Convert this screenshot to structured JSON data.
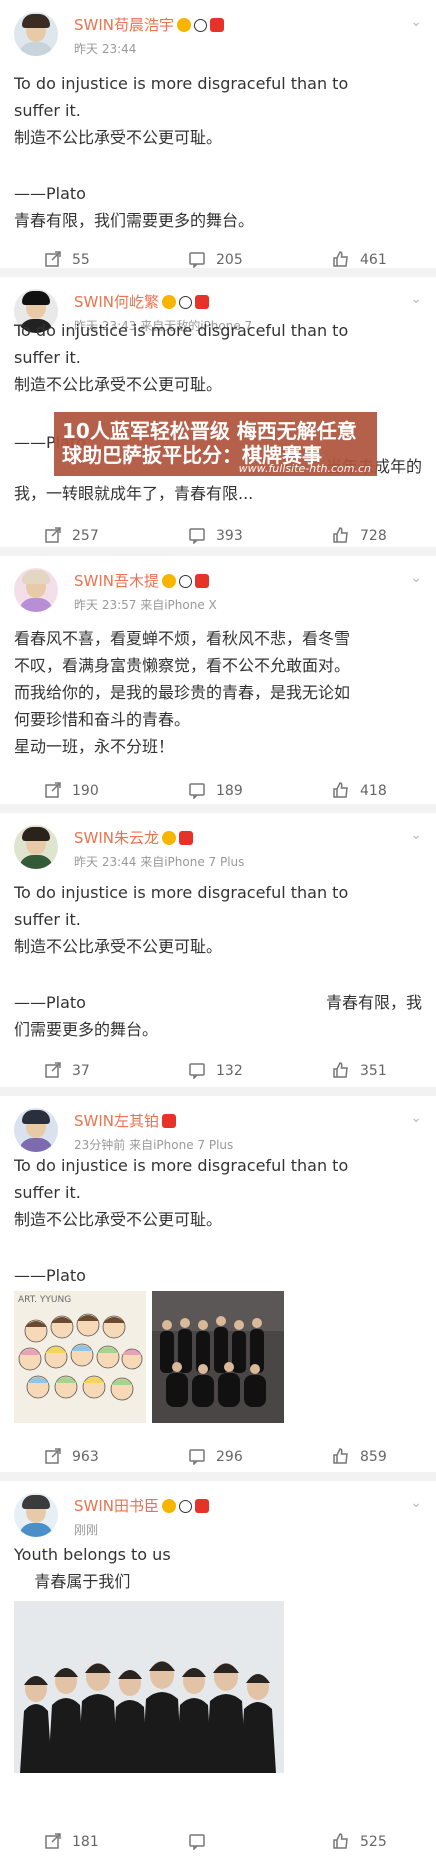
{
  "posts": [
    {
      "username": "SWIN苟晨浩宇",
      "meta": "昨天 23:44",
      "text_en": "To do injustice is more disgraceful than to\nsuffer it.",
      "text_zh": "制造不公比承受不公更可耻。",
      "signature": "——Plato",
      "extra": "青春有限，我们需要更多的舞台。",
      "actions": {
        "repost": "55",
        "comment": "205",
        "like": "461"
      }
    },
    {
      "username": "SWIN何屹繁",
      "meta": "昨天 23:43  来自无敌的iPhone 7",
      "text_en": "To do injustice is more disgraceful than to\nsuffer it.",
      "text_zh": "制造不公比承受不公更可耻。",
      "signature": "——Plato",
      "side_note": "当年未成年的",
      "extra": "我，一转眼就成年了，青春有限...",
      "actions": {
        "repost": "257",
        "comment": "393",
        "like": "728"
      }
    },
    {
      "username": "SWIN吾木提",
      "meta": "昨天 23:57  来自iPhone X",
      "text": "看春风不喜，看夏蝉不烦，看秋风不悲，看冬雪\n不叹，看满身富贵懒察觉，看不公不允敢面对。\n而我给你的，是我的最珍贵的青春，是我无论如\n何要珍惜和奋斗的青春。\n星动一班，永不分班！",
      "actions": {
        "repost": "190",
        "comment": "189",
        "like": "418"
      }
    },
    {
      "username": "SWIN朱云龙",
      "meta": "昨天 23:44  来自iPhone 7 Plus",
      "text_en": "To do injustice is more disgraceful than to\nsuffer it.",
      "text_zh": "制造不公比承受不公更可耻。",
      "signature": "——Plato",
      "side_note": "青春有限，我",
      "extra": "们需要更多的舞台。",
      "actions": {
        "repost": "37",
        "comment": "132",
        "like": "351"
      }
    },
    {
      "username": "SWIN左其铂",
      "meta": "23分钟前  来自iPhone 7 Plus",
      "text_en": "To do injustice is more disgraceful than to\nsuffer it.",
      "text_zh": "制造不公比承受不公更可耻。",
      "signature": "——Plato",
      "image_caption": "ART. YYUNG",
      "actions": {
        "repost": "963",
        "comment": "296",
        "like": "859"
      }
    },
    {
      "username": "SWIN田书臣",
      "meta": "刚刚",
      "text_en": "Youth belongs to us",
      "text_zh": "    青春属于我们",
      "actions": {
        "repost": "181",
        "comment": "",
        "like": "525"
      }
    }
  ],
  "banner": {
    "line1": "10人蓝军轻松晋级 梅西无解任意",
    "line2": "球助巴萨扳平比分：棋牌赛事",
    "url": "www.fullsite-hth.com.cn"
  },
  "colors": {
    "username": "#eb7350",
    "meta": "#999999",
    "separator": "#f2f2f2",
    "banner_bg": "#b0543e"
  }
}
